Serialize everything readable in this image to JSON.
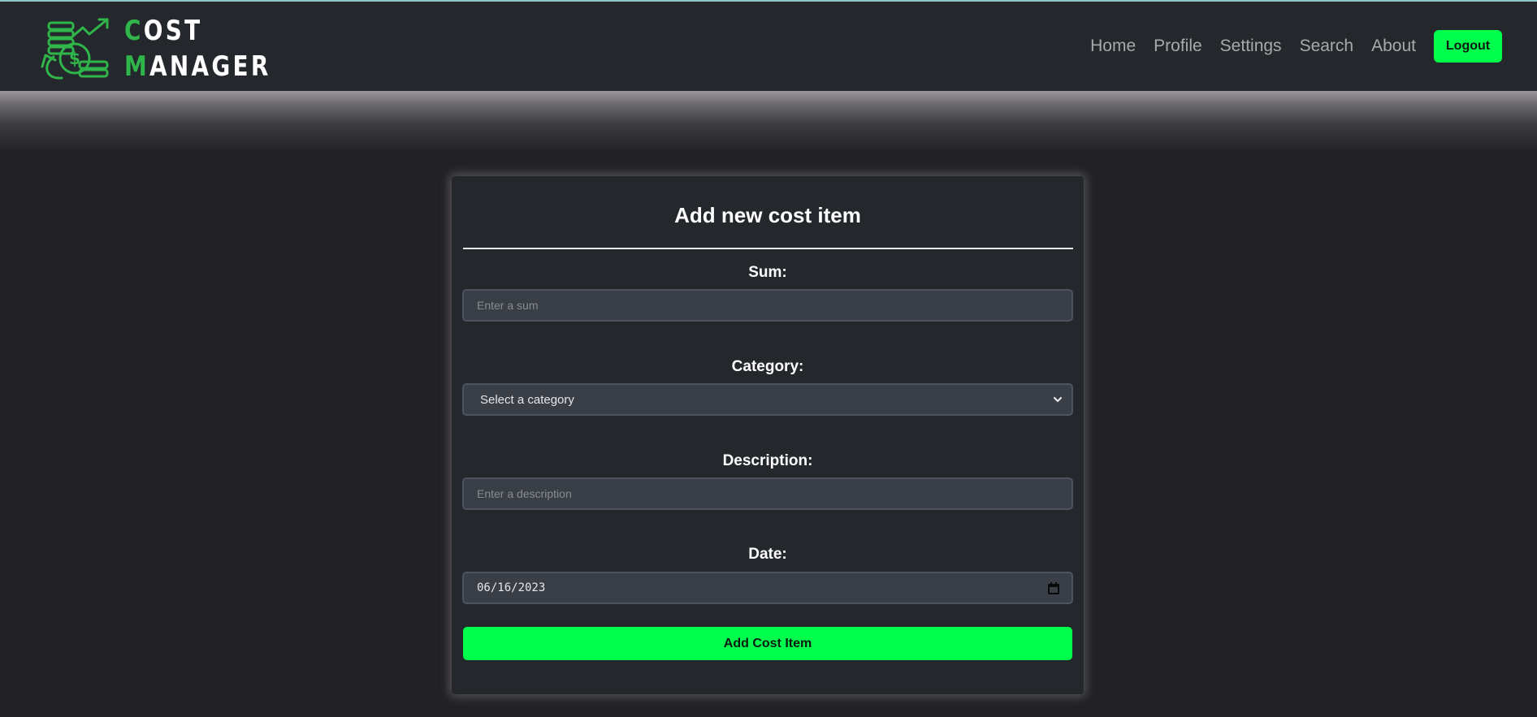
{
  "brand": {
    "line1_first": "C",
    "line1_rest": "OST",
    "line2_first": "M",
    "line2_rest": "ANAGER"
  },
  "nav": {
    "links": [
      "Home",
      "Profile",
      "Settings",
      "Search",
      "About"
    ],
    "logout_label": "Logout"
  },
  "form": {
    "title": "Add new cost item",
    "sum": {
      "label": "Sum:",
      "placeholder": "Enter a sum"
    },
    "category": {
      "label": "Category:",
      "selected": "Select a category"
    },
    "description": {
      "label": "Description:",
      "placeholder": "Enter a description"
    },
    "date": {
      "label": "Date:",
      "value": "06/16/2023"
    },
    "submit_label": "Add Cost Item"
  },
  "colors": {
    "accent": "#00ff4c",
    "brand_green": "#2fb54a",
    "navbar": "#24282d",
    "background": "#222126"
  }
}
